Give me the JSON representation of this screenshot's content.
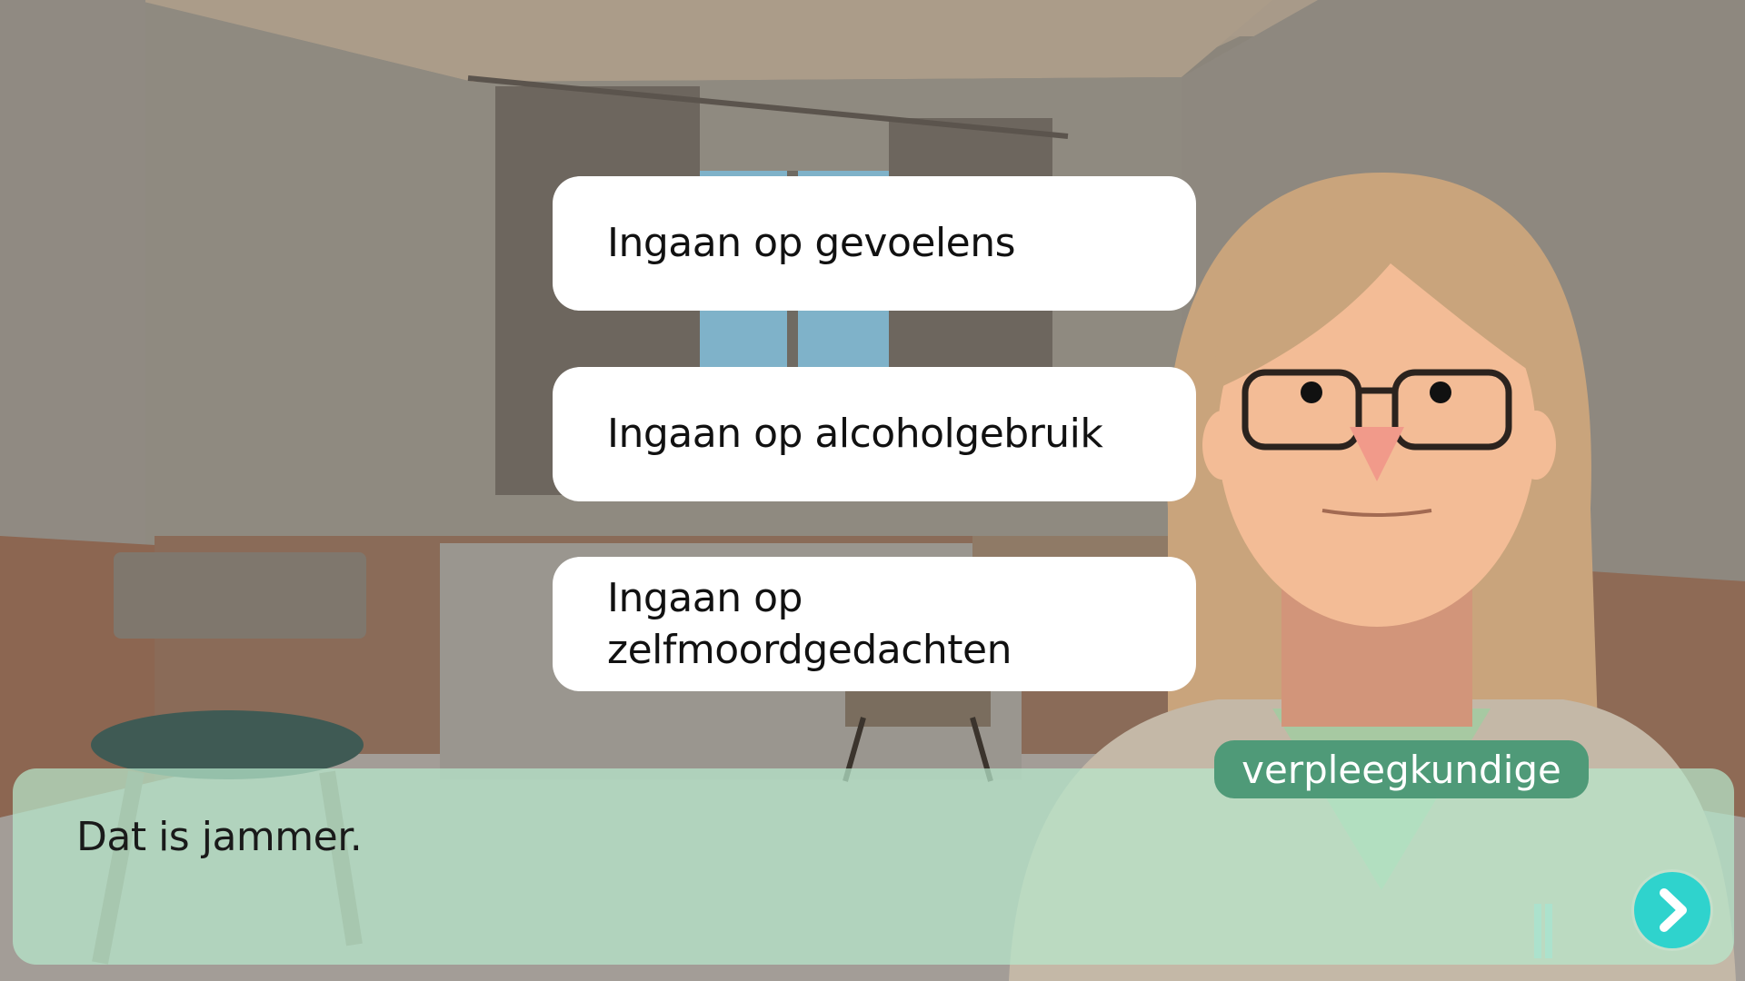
{
  "choices": [
    {
      "label": "Ingaan op gevoelens"
    },
    {
      "label": "Ingaan op alcoholgebruik"
    },
    {
      "label": "Ingaan op zelfmoordgedachten"
    }
  ],
  "dialog": {
    "speaker": "verpleegkundige",
    "text": "Dat is jammer."
  },
  "controls": {
    "next_icon": "chevron-right-icon"
  },
  "colors": {
    "dialog_bg": "#b7e8cc",
    "speaker_bg": "#4f9a78",
    "next_button": "#2fd3cd",
    "choice_bg": "#ffffff"
  }
}
